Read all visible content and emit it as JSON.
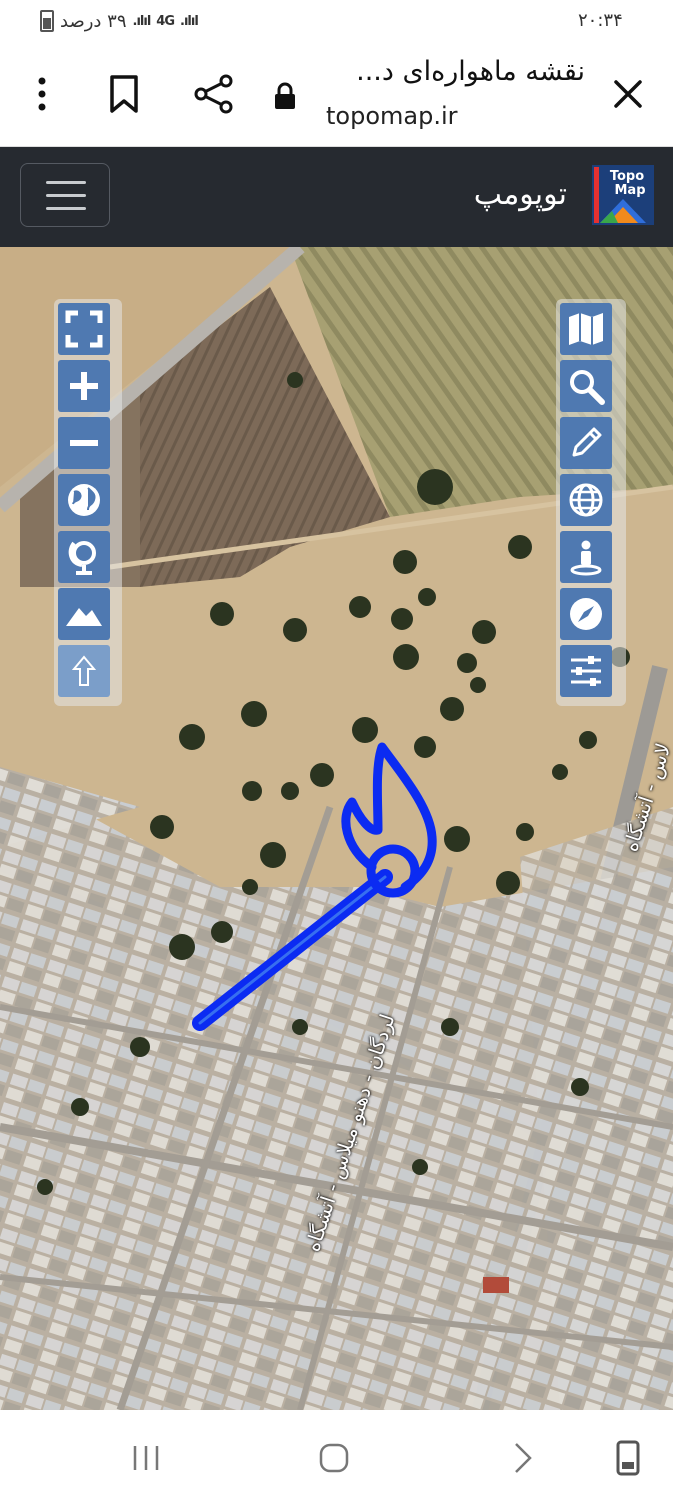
{
  "status_bar": {
    "time": "۲۰:۳۴",
    "battery_text": "۳۹ درصد",
    "network": "4G"
  },
  "browser": {
    "page_title": "نقشه ماهواره‌ای د...",
    "url": "topomap.ir"
  },
  "site": {
    "name": "توپومپ",
    "logo_text_1": "Topo",
    "logo_text_2": "Map"
  },
  "map": {
    "road_labels": [
      "لردگان - دهنو میلاس - آتشگاه",
      "لاس - آتشگاه"
    ],
    "left_tools": [
      "fullscreen-icon",
      "zoom-in-icon",
      "zoom-out-icon",
      "globe-icon",
      "globe-stand-icon",
      "mountain-icon",
      "up-arrow-icon"
    ],
    "right_tools": [
      "map-icon",
      "search-icon",
      "pencil-icon",
      "globe-grid-icon",
      "person-pin-icon",
      "compass-icon",
      "sliders-icon"
    ]
  },
  "colors": {
    "header_bg": "#262a30",
    "tool_button": "#4f79b1",
    "annotation": "#0b2bf2"
  }
}
